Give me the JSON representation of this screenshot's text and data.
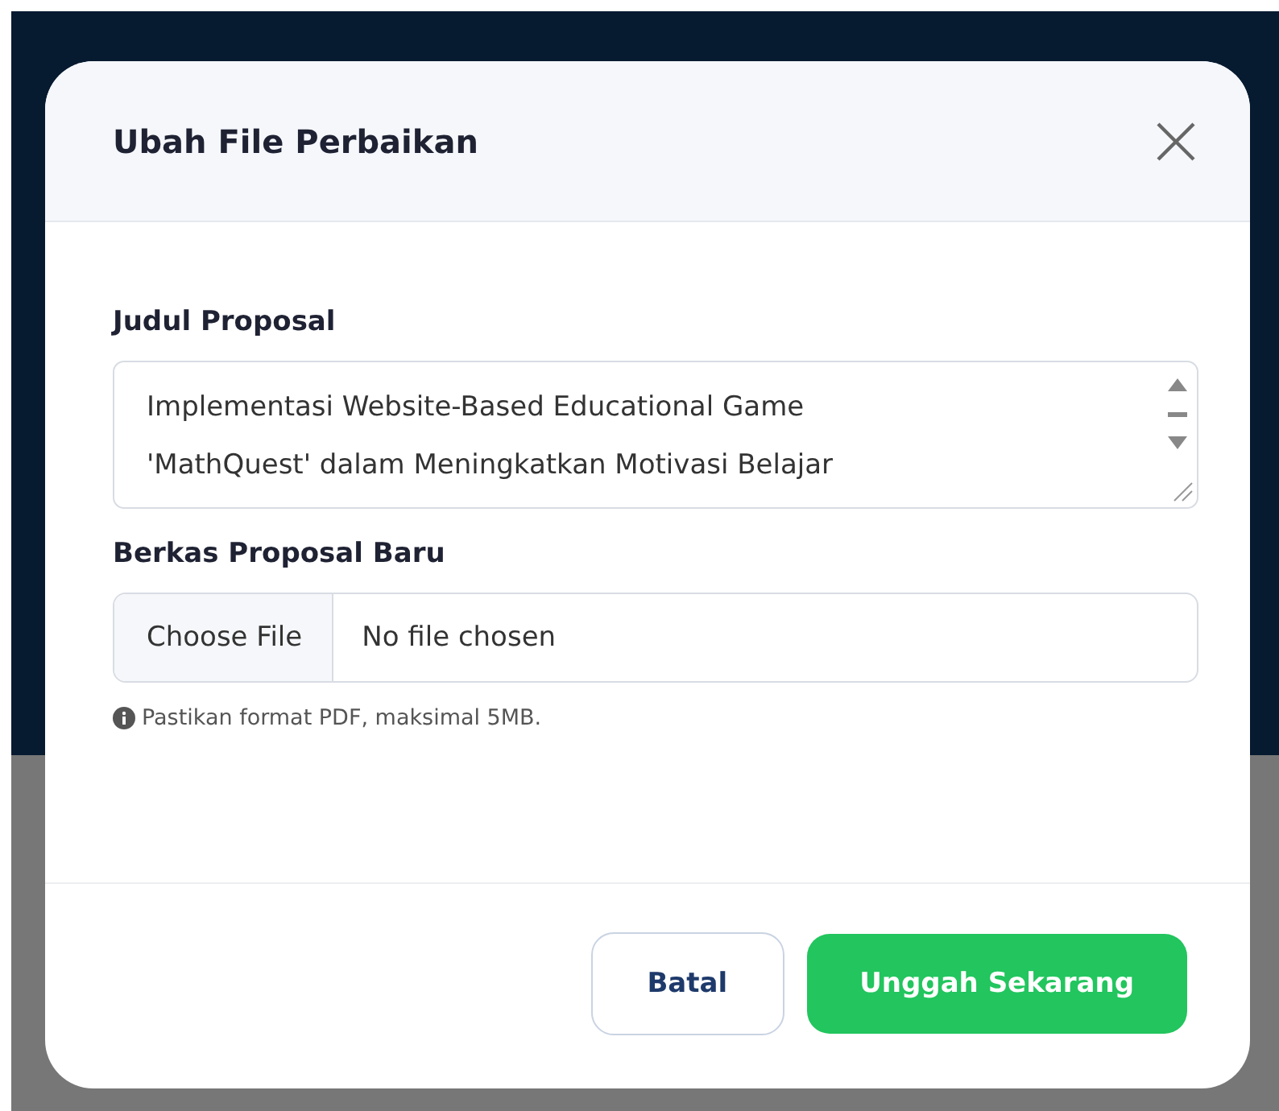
{
  "dialog": {
    "title": "Ubah File Perbaikan",
    "fields": [
      {
        "kind": "textarea",
        "label": "Judul Proposal",
        "value": "Implementasi Website-Based Educational Game 'MathQuest' dalam Meningkatkan Motivasi Belajar"
      },
      {
        "kind": "file",
        "label": "Berkas Proposal Baru",
        "button": "Choose File",
        "value": "No file chosen",
        "hint": "Pastikan format PDF, maksimal 5MB."
      }
    ],
    "buttons": [
      {
        "kind": "secondary",
        "label": "Batal"
      },
      {
        "kind": "primary",
        "label": "Unggah Sekarang"
      }
    ]
  }
}
